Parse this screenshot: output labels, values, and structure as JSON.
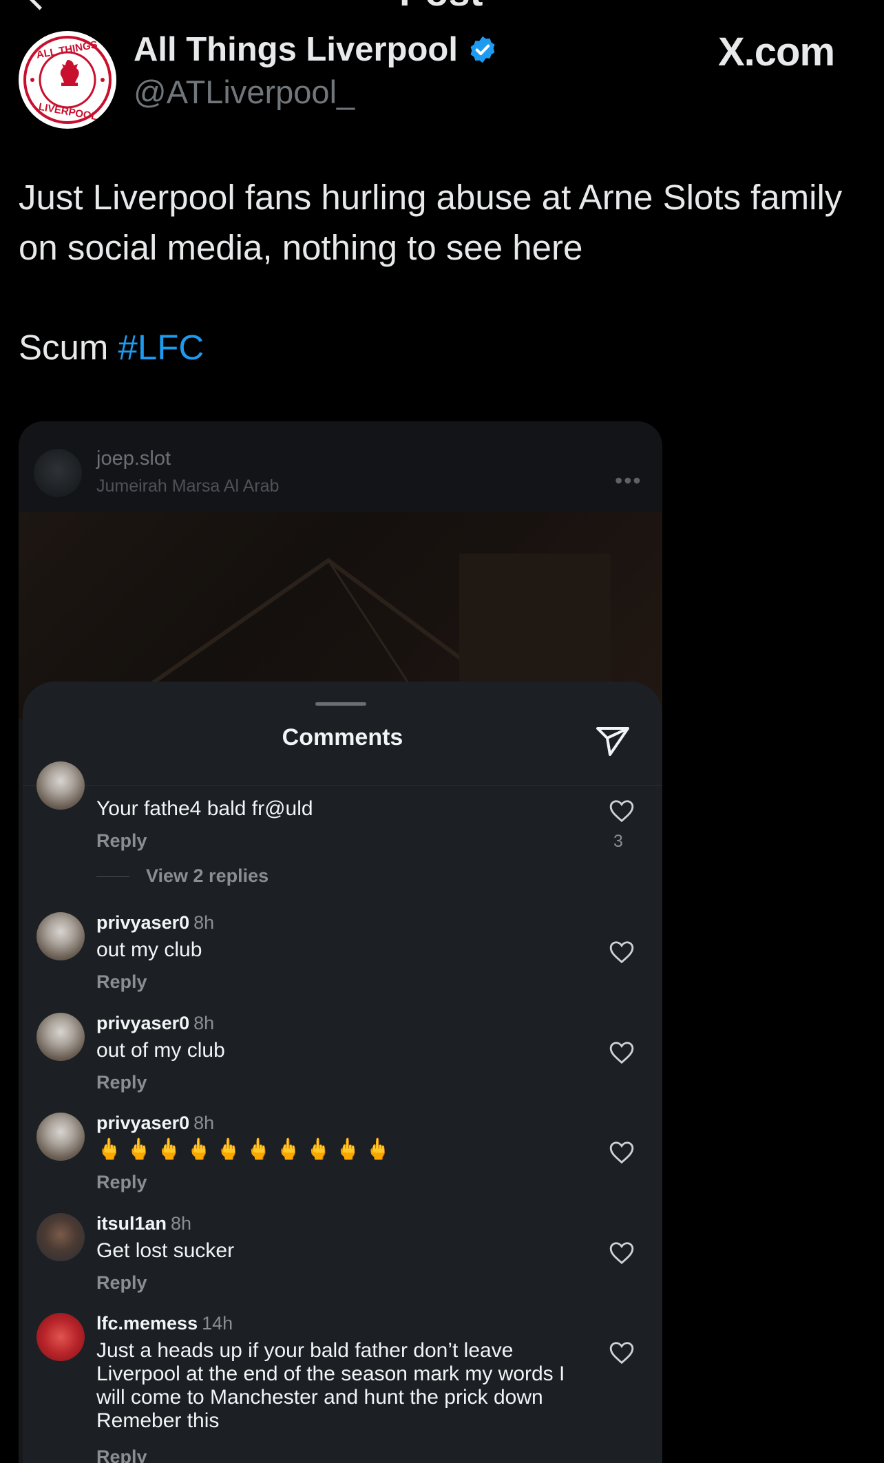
{
  "header": {
    "title": "Post"
  },
  "author": {
    "name": "All Things Liverpool",
    "handle": "@ATLiverpool_",
    "badge_text_top": "ALL THINGS",
    "badge_text_bottom": "LIVERPOOL",
    "watermark": "X.com"
  },
  "tweet": {
    "line1": "Just Liverpool fans hurling abuse at Arne Slots family on social media, nothing to see here",
    "scum": "Scum",
    "hashtag": "#LFC"
  },
  "ig_post": {
    "username": "joep.slot",
    "location": "Jumeirah Marsa Al Arab",
    "more": "•••"
  },
  "comments_sheet": {
    "title": "Comments",
    "colors": {
      "sheet": "#1c1f23",
      "text": "#f2f4f6",
      "muted": "#8a8e93"
    },
    "comments": [
      {
        "username": "",
        "time": "",
        "text": "Your fathe4 bald fr@uld",
        "reply": "Reply",
        "likes": "3",
        "view_replies": "View 2 replies"
      },
      {
        "username": "privyaser0",
        "time": "8h",
        "text": "out my club",
        "reply": "Reply"
      },
      {
        "username": "privyaser0",
        "time": "8h",
        "text": "out of my club",
        "reply": "Reply"
      },
      {
        "username": "privyaser0",
        "time": "8h",
        "text": "🖕🖕🖕🖕🖕🖕🖕🖕🖕🖕",
        "reply": "Reply"
      },
      {
        "username": "itsul1an",
        "time": "8h",
        "text": "Get lost sucker",
        "reply": "Reply"
      },
      {
        "username": "lfc.memess",
        "time": "14h",
        "text": "Just a heads up if your bald father don’t leave Liverpool at the end of the season mark my words I will come to Manchester and hunt the prick down Remeber this",
        "reply": "Reply"
      }
    ]
  }
}
